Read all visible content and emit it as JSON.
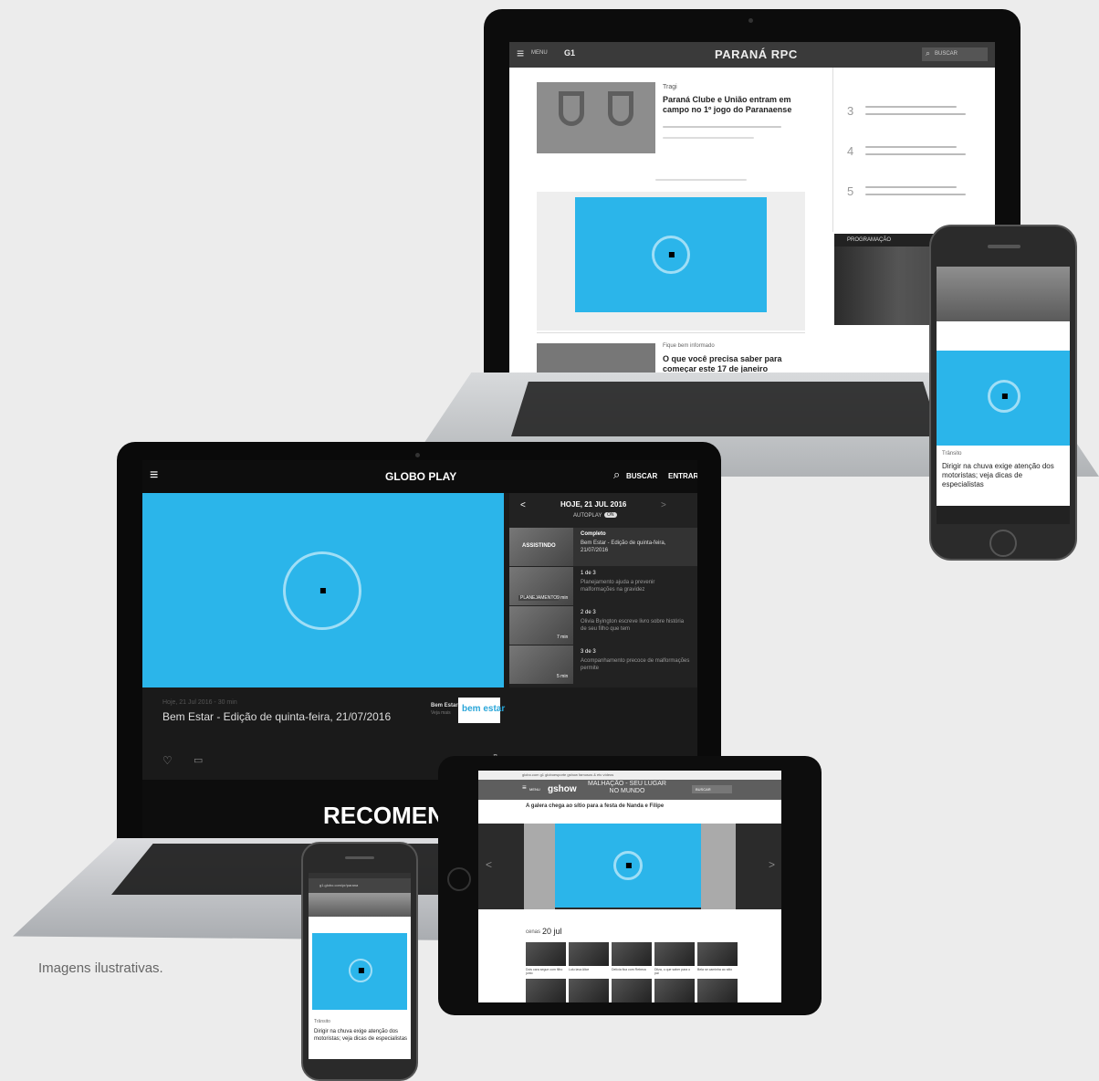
{
  "caption": "Imagens ilustrativas.",
  "laptop_back": {
    "brand": "PARANÁ RPC",
    "search_label": "BUSCAR",
    "menu_label": "MENU",
    "g1_label": "G1",
    "article_kicker": "Tragi",
    "article_title": "Paraná Clube e União entram em campo no 1º jogo do Paranaense",
    "article2_kicker": "Fique bem informado",
    "article2_title": "O que você precisa saber para começar este 17 de janeiro",
    "ranking": [
      "3",
      "4",
      "5"
    ],
    "programacao_label": "PROGRAMAÇÃO"
  },
  "phone_right": {
    "kicker": "Trânsito",
    "headline": "Dirigir na chuva exige atenção dos motoristas; veja dicas de especialistas"
  },
  "laptop_front": {
    "logo": "GLOBO PLAY",
    "search_label": "BUSCAR",
    "login_label": "ENTRAR",
    "date_header": "HOJE, 21 JUL 2016",
    "autoplay_label": "AUTOPLAY",
    "autoplay_state": "ON",
    "meta": "Hoje, 21 Jul 2016 - 30 min",
    "video_title": "Bem Estar - Edição de quinta-feira, 21/07/2016",
    "program_name": "Bem Estar",
    "program_link": "Veja mais",
    "program_logo": "bem estar",
    "recommend_heading": "RECOMEN",
    "playlist": [
      {
        "badge": "ASSISTINDO",
        "index": "Completo",
        "title": "Bem Estar - Edição de quinta-feira, 21/07/2016",
        "duration": ""
      },
      {
        "badge": "PLANEJAMENTO",
        "index": "1 de 3",
        "title": "Planejamento ajuda a prevenir malformações na gravidez",
        "duration": "9 min"
      },
      {
        "badge": "",
        "index": "2 de 3",
        "title": "Olivia Byington escreve livro sobre história de seu filho que tem",
        "duration": "7 min"
      },
      {
        "badge": "",
        "index": "3 de 3",
        "title": "Acompanhamento precoce de malformações permite",
        "duration": "5 min"
      }
    ]
  },
  "tablet": {
    "top_links": "globo.com  g1  globoesporte  gshow  famosos & etc  vídeos",
    "brand": "gshow",
    "menu_label": "MENU",
    "program_title": "MALHAÇÃO - SEU LUGAR NO MUNDO",
    "search_label": "BUSCAR",
    "headline": "A galera chega ao sítio para a festa de Nanda e Filipe",
    "date_prefix": "cenas",
    "date_value": "20 jul",
    "thumb_captions": [
      "Dois cara segue com filho junto",
      "Lulu lava Alice",
      "Delícia fica com Rebeca",
      "Dilza, o que saber para o pai",
      "Bela se caminha ao sítio"
    ]
  },
  "phone_left": {
    "url": "g1.globo.com/pr/parana",
    "kicker": "Trânsito",
    "headline": "Dirigir na chuva exige atenção dos motoristas; veja dicas de especialistas"
  },
  "colors": {
    "background": "#ececec",
    "video_blue": "#2bb5ea",
    "device_black": "#111111",
    "aluminum": "#c9cbce"
  }
}
